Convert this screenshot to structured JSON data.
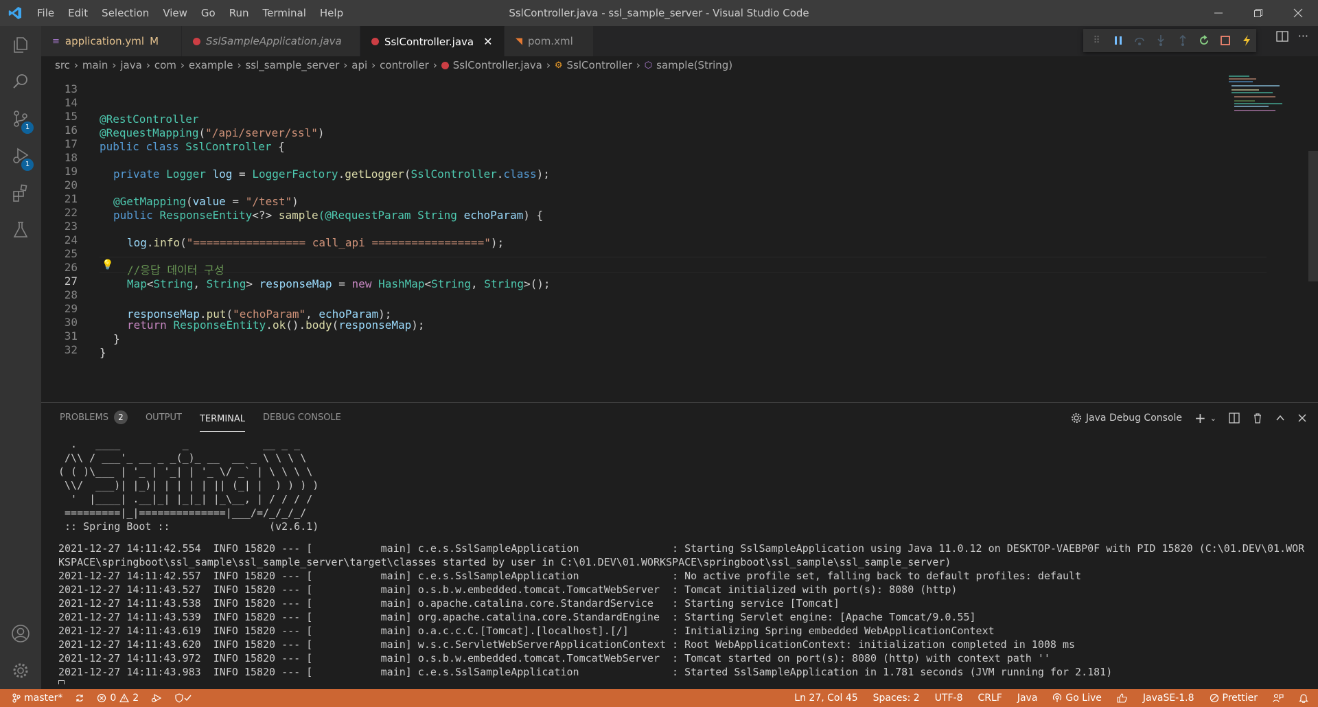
{
  "window": {
    "title": "SslController.java - ssl_sample_server - Visual Studio Code"
  },
  "menu": [
    "File",
    "Edit",
    "Selection",
    "View",
    "Go",
    "Run",
    "Terminal",
    "Help"
  ],
  "activity": {
    "scm_badge": "1",
    "debug_badge": "1"
  },
  "tabs": [
    {
      "name": "application.yml",
      "status": "M"
    },
    {
      "name": "SslSampleApplication.java"
    },
    {
      "name": "SslController.java"
    },
    {
      "name": "pom.xml"
    }
  ],
  "breadcrumb": [
    "src",
    "main",
    "java",
    "com",
    "example",
    "ssl_sample_server",
    "api",
    "controller",
    "SslController.java",
    "SslController",
    "sample(String)"
  ],
  "editor": {
    "line_numbers": [
      "13",
      "14",
      "15",
      "16",
      "17",
      "18",
      "19",
      "20",
      "21",
      "22",
      "23",
      "24",
      "25",
      "26",
      "27",
      "28",
      "29",
      "30",
      "31",
      "32"
    ],
    "current_line": "27",
    "code": {
      "l14": [
        "@",
        "RestController"
      ],
      "l15": [
        "@",
        "RequestMapping",
        "(",
        "\"/api/server/ssl\"",
        ")"
      ],
      "l16": [
        "public",
        " ",
        "class",
        " ",
        "SslController",
        " {"
      ],
      "l18": [
        "private",
        " ",
        "Logger",
        " ",
        "log",
        " = ",
        "LoggerFactory",
        ".",
        "getLogger",
        "(",
        "SslController",
        ".",
        "class",
        ");"
      ],
      "l20": [
        "@",
        "GetMapping",
        "(",
        "value",
        " = ",
        "\"/test\"",
        ")"
      ],
      "l21": [
        "public",
        " ",
        "ResponseEntity",
        "<?> ",
        "sample",
        "(@",
        "RequestParam",
        " ",
        "String",
        " ",
        "echoParam",
        ") {"
      ],
      "l23": [
        "log",
        ".",
        "info",
        "(",
        "\"================= call_api =================\"",
        ");"
      ],
      "l25": [
        "//응답 데이터 구성"
      ],
      "l26": [
        "Map",
        "<",
        "String",
        ", ",
        "String",
        "> ",
        "responseMap",
        " = ",
        "new",
        " ",
        "HashMap",
        "<",
        "String",
        ", ",
        "String",
        ">();"
      ],
      "l27": [
        "responseMap",
        ".",
        "put",
        "(",
        "\"echoParam\"",
        ", ",
        "echoParam",
        ");"
      ],
      "l29": [
        "return",
        " ",
        "ResponseEntity",
        ".",
        "ok",
        "().",
        "body",
        "(",
        "responseMap",
        ");"
      ],
      "l30": [
        "}"
      ],
      "l31": [
        "}"
      ]
    }
  },
  "panel": {
    "tabs": [
      "PROBLEMS",
      "OUTPUT",
      "TERMINAL",
      "DEBUG CONSOLE"
    ],
    "problems_count": "2",
    "active_tab": "TERMINAL",
    "console_select": "Java Debug Console",
    "terminal_lines": [
      "  .   ____          _            __ _ _",
      " /\\\\ / ___'_ __ _ _(_)_ __  __ _ \\ \\ \\ \\",
      "( ( )\\___ | '_ | '_| | '_ \\/ _` | \\ \\ \\ \\",
      " \\\\/  ___)| |_)| | | | | || (_| |  ) ) ) )",
      "  '  |____| .__|_| |_|_| |_\\__, | / / / /",
      " =========|_|==============|___/=/_/_/_/",
      " :: Spring Boot ::                (v2.6.1)",
      "",
      "2021-12-27 14:11:42.554  INFO 15820 --- [           main] c.e.s.SslSampleApplication               : Starting SslSampleApplication using Java 11.0.12 on DESKTOP-VAEBP0F with PID 15820 (C:\\01.DEV\\01.WOR",
      "KSPACE\\springboot\\ssl_sample\\ssl_sample_server\\target\\classes started by user in C:\\01.DEV\\01.WORKSPACE\\springboot\\ssl_sample\\ssl_sample_server)",
      "2021-12-27 14:11:42.557  INFO 15820 --- [           main] c.e.s.SslSampleApplication               : No active profile set, falling back to default profiles: default",
      "2021-12-27 14:11:43.527  INFO 15820 --- [           main] o.s.b.w.embedded.tomcat.TomcatWebServer  : Tomcat initialized with port(s): 8080 (http)",
      "2021-12-27 14:11:43.538  INFO 15820 --- [           main] o.apache.catalina.core.StandardService   : Starting service [Tomcat]",
      "2021-12-27 14:11:43.539  INFO 15820 --- [           main] org.apache.catalina.core.StandardEngine  : Starting Servlet engine: [Apache Tomcat/9.0.55]",
      "2021-12-27 14:11:43.619  INFO 15820 --- [           main] o.a.c.c.C.[Tomcat].[localhost].[/]       : Initializing Spring embedded WebApplicationContext",
      "2021-12-27 14:11:43.620  INFO 15820 --- [           main] w.s.c.ServletWebServerApplicationContext : Root WebApplicationContext: initialization completed in 1008 ms",
      "2021-12-27 14:11:43.972  INFO 15820 --- [           main] o.s.b.w.embedded.tomcat.TomcatWebServer  : Tomcat started on port(s): 8080 (http) with context path ''",
      "2021-12-27 14:11:43.983  INFO 15820 --- [           main] c.e.s.SslSampleApplication               : Started SslSampleApplication in 1.781 seconds (JVM running for 2.181)"
    ]
  },
  "statusbar": {
    "branch": "master*",
    "errors": "0",
    "warnings": "2",
    "position": "Ln 27, Col 45",
    "spaces": "Spaces: 2",
    "encoding": "UTF-8",
    "eol": "CRLF",
    "language": "Java",
    "golive": "Go Live",
    "javase": "JavaSE-1.8",
    "prettier": "Prettier"
  },
  "colors": {
    "statusbar": "#cc6633",
    "titlebar": "#3c3c3c",
    "activitybar": "#333333",
    "editor_bg": "#1e1e1e",
    "badge": "#0e639c"
  }
}
